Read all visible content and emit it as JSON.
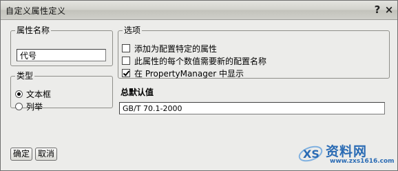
{
  "window": {
    "title": "自定义属性定义",
    "help_label": "?",
    "close_label": "×"
  },
  "name_group": {
    "legend": "属性名称",
    "value": "代号"
  },
  "type_group": {
    "legend": "类型",
    "options": [
      {
        "label": "文本框",
        "selected": true
      },
      {
        "label": "列举",
        "selected": false
      }
    ]
  },
  "options_group": {
    "legend": "选项",
    "items": [
      {
        "label": "添加为配置特定的属性",
        "checked": false
      },
      {
        "label": "此属性的每个数值需要新的配置名称",
        "checked": false
      },
      {
        "label": "在 PropertyManager 中显示",
        "checked": true
      }
    ]
  },
  "default_value": {
    "label": "总默认值",
    "value": "GB/T 70.1-2000"
  },
  "buttons": {
    "ok": "确定",
    "cancel": "取消"
  },
  "watermark": {
    "text": "资料网",
    "url": "www.zxs1616.com",
    "logo_text": "XS",
    "accent": "#2a6bb4"
  }
}
